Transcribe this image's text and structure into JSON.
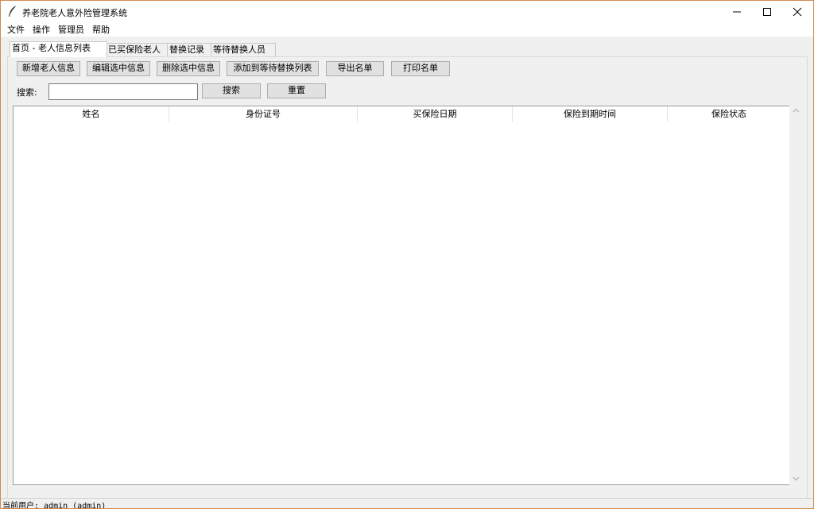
{
  "window": {
    "title": "养老院老人意外险管理系统",
    "accent_border_color": "#d08a52"
  },
  "menu": [
    {
      "label": "文件"
    },
    {
      "label": "操作"
    },
    {
      "label": "管理员"
    },
    {
      "label": "帮助"
    }
  ],
  "tabs": [
    {
      "label": "首页 - 老人信息列表",
      "active": true
    },
    {
      "label": "已买保险老人",
      "active": false
    },
    {
      "label": "替换记录",
      "active": false
    },
    {
      "label": "等待替换人员",
      "active": false
    }
  ],
  "toolbar": {
    "add_label": "新增老人信息",
    "edit_label": "编辑选中信息",
    "delete_label": "删除选中信息",
    "add_wait_label": "添加到等待替换列表",
    "export_label": "导出名单",
    "print_label": "打印名单"
  },
  "search": {
    "label": "搜索:",
    "value": "",
    "search_button": "搜索",
    "reset_button": "重置"
  },
  "table": {
    "columns": [
      "姓名",
      "身份证号",
      "买保险日期",
      "保险到期时间",
      "保险状态"
    ],
    "rows": []
  },
  "status": {
    "text": "当前用户: admin (admin)"
  }
}
